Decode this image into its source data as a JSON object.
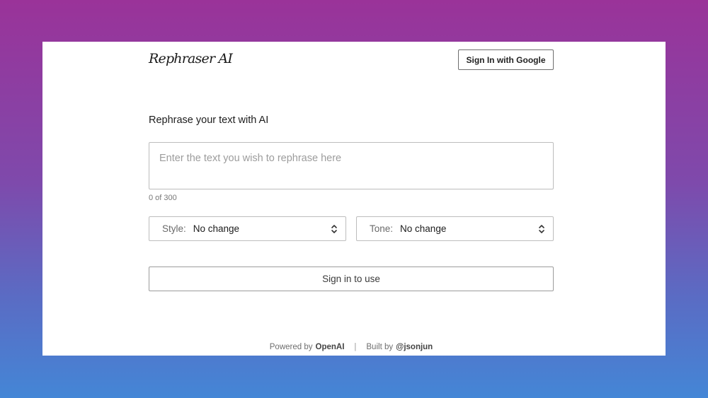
{
  "header": {
    "logo": "Rephraser AI",
    "signin_label": "Sign In with Google"
  },
  "main": {
    "title": "Rephrase your text with AI",
    "input_placeholder": "Enter the text you wish to rephrase here",
    "input_value": "",
    "char_count": "0 of 300",
    "style": {
      "label": "Style:",
      "value": "No change"
    },
    "tone": {
      "label": "Tone:",
      "value": "No change"
    },
    "submit_label": "Sign in to use"
  },
  "footer": {
    "powered_prefix": "Powered by",
    "powered_link": "OpenAI",
    "separator": "|",
    "built_prefix": "Built by",
    "built_link": "@jsonjun"
  },
  "icons": {
    "select_chevron": "chevron-up-down-icon"
  }
}
